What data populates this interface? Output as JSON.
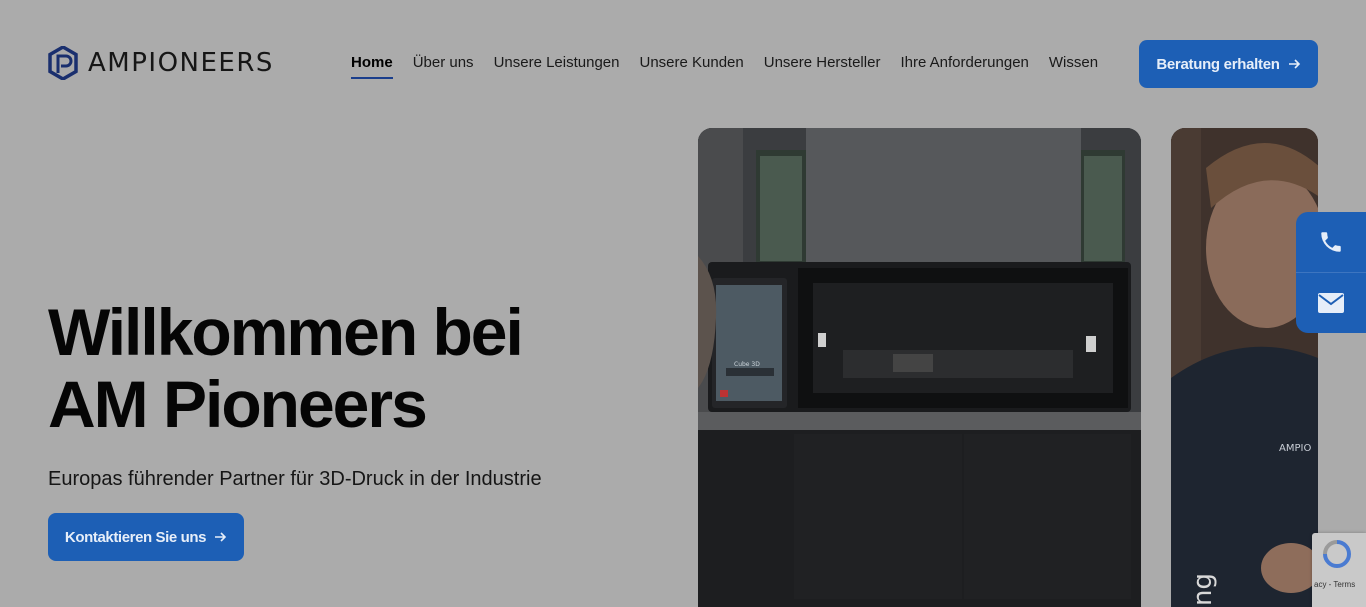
{
  "brand": {
    "logo_text": "AMPIONEERS"
  },
  "nav": {
    "items": [
      {
        "label": "Home",
        "active": true
      },
      {
        "label": "Über uns"
      },
      {
        "label": "Unsere Leistungen"
      },
      {
        "label": "Unsere Kunden"
      },
      {
        "label": "Unsere Hersteller"
      },
      {
        "label": "Ihre Anforderungen"
      },
      {
        "label": "Wissen"
      }
    ],
    "cta_label": "Beratung erhalten"
  },
  "hero": {
    "title_line1": "Willkommen bei",
    "title_line2": "AM Pioneers",
    "subtitle": "Europas führender Partner für 3D-Druck in der Industrie",
    "cta_label": "Kontaktieren Sie uns"
  },
  "images": {
    "printer_screen_text": "Cube 3D",
    "person_shirt_text": "AMPIO",
    "person_vertical_text": "ng"
  },
  "recaptcha": {
    "text": "acy - Terms"
  },
  "colors": {
    "accent": "#1d5fb5",
    "background": "#ababab",
    "nav_underline": "#1a3e8c"
  },
  "icons": [
    "logo-hexagon-icon",
    "arrow-right-icon",
    "phone-icon",
    "mail-icon",
    "recaptcha-icon"
  ]
}
